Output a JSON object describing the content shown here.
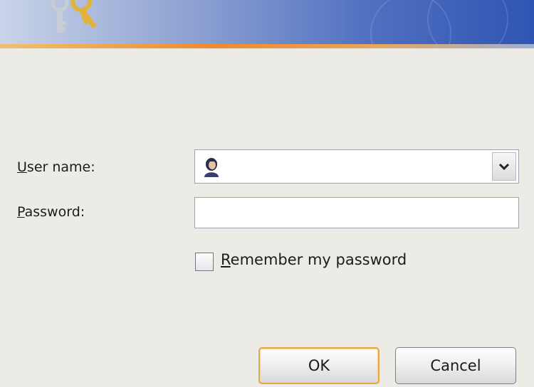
{
  "dialog": {
    "user_label_mnemonic": "U",
    "user_label_rest": "ser name:",
    "password_label_mnemonic": "P",
    "password_label_rest": "assword:",
    "username_value": "",
    "password_value": "",
    "remember_mnemonic": "R",
    "remember_rest": "emember my password",
    "remember_checked": false,
    "ok_label": "OK",
    "cancel_label": "Cancel"
  },
  "icons": {
    "banner": "keys-icon",
    "user": "user-icon",
    "dropdown": "chevron-down-icon"
  },
  "colors": {
    "banner_start": "#c9d4e8",
    "banner_end": "#2f55b3",
    "accent_stripe": "#f08a2c",
    "default_button_border": "#e3a84b",
    "dialog_background": "#ecebe6"
  }
}
